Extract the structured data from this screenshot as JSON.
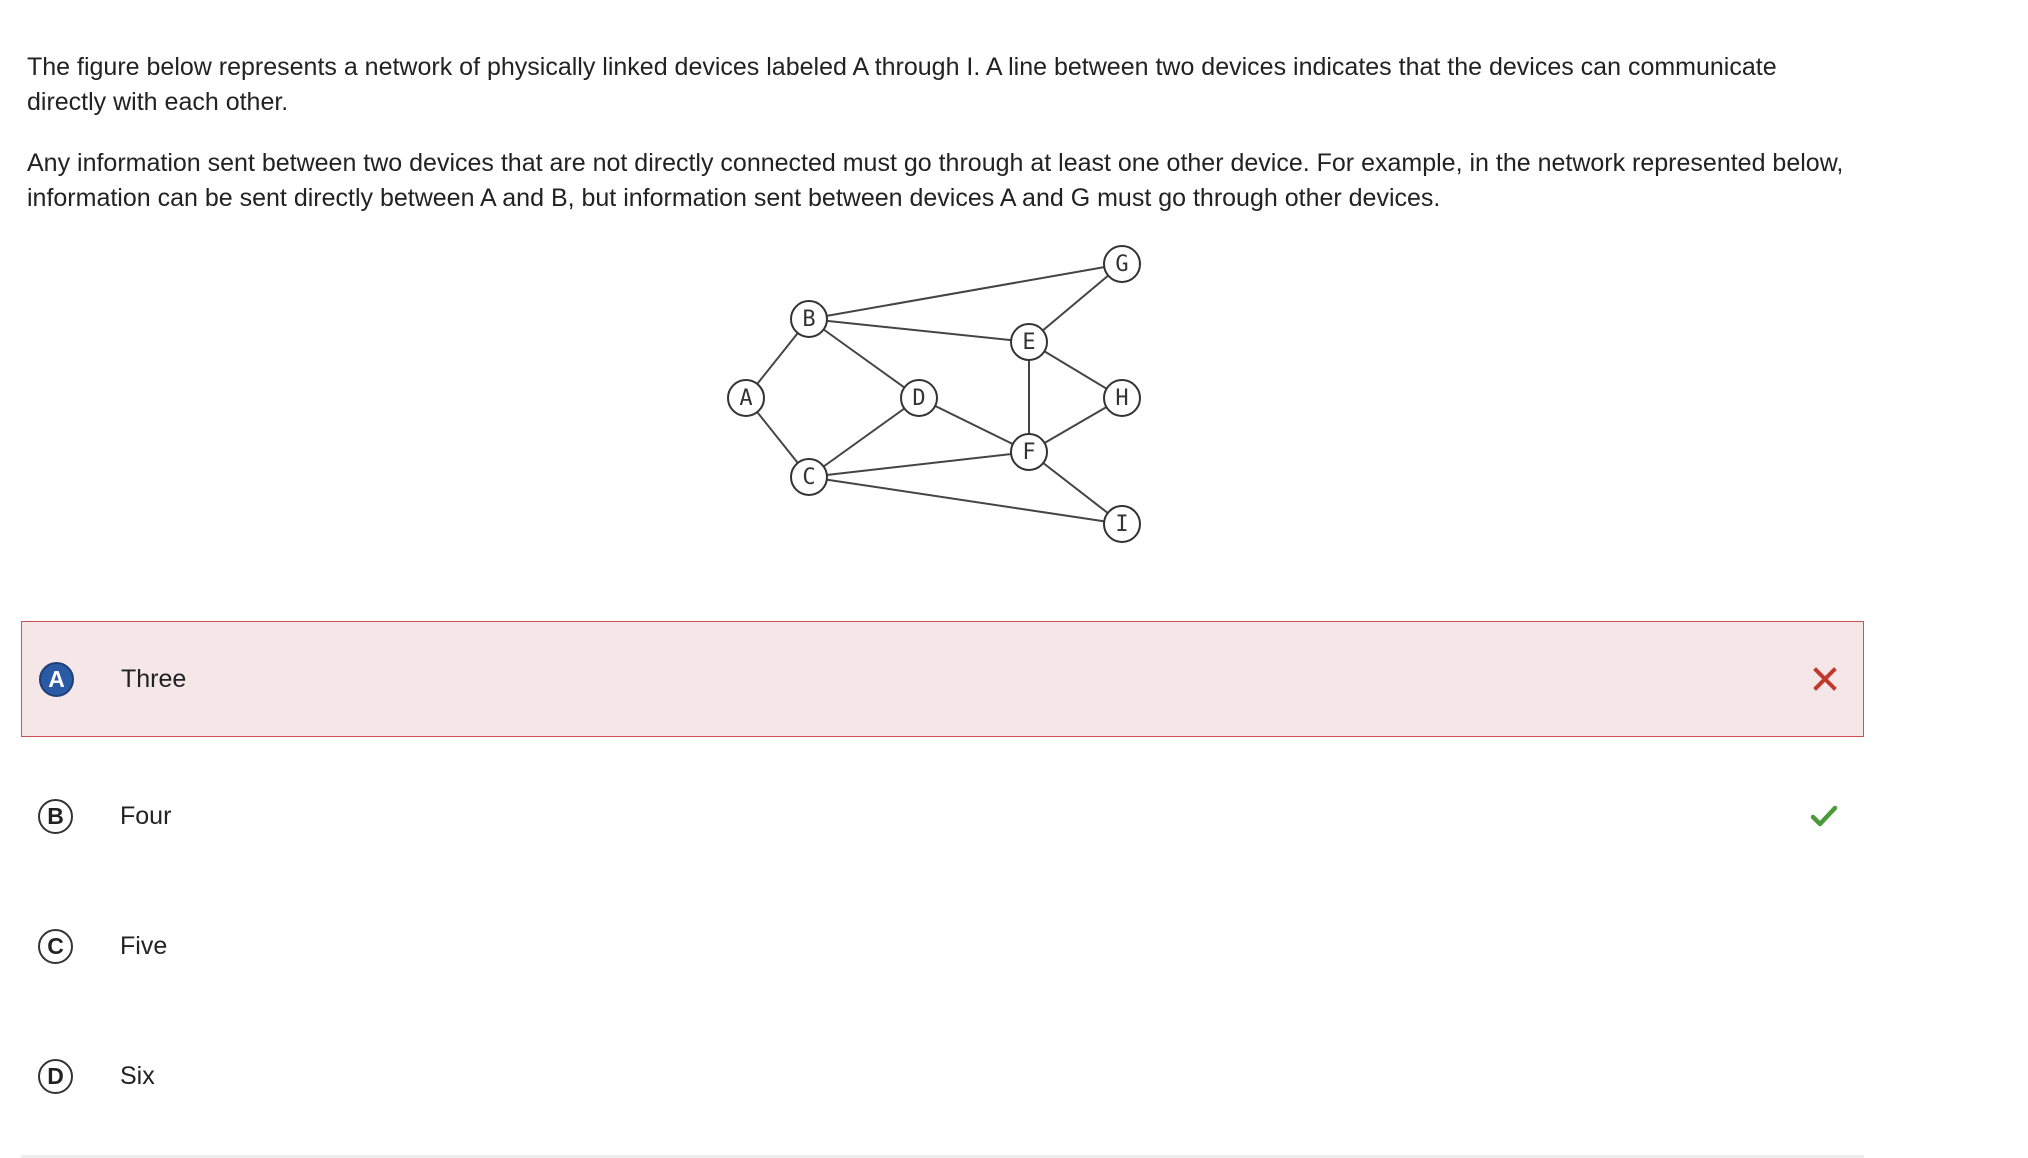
{
  "question": {
    "paragraph_1": "The figure below represents a network of physically linked devices labeled A through I. A line between two devices indicates that the devices can communicate directly with each other.",
    "paragraph_2": "Any information sent between two devices that are not directly connected must go through at least one other device. For example, in the network represented below, information can be sent directly between A and B, but information sent between devices A and G must go through other devices."
  },
  "network": {
    "nodes": [
      "A",
      "B",
      "C",
      "D",
      "E",
      "F",
      "G",
      "H",
      "I"
    ],
    "edges": [
      [
        "A",
        "B"
      ],
      [
        "A",
        "C"
      ],
      [
        "B",
        "D"
      ],
      [
        "B",
        "E"
      ],
      [
        "B",
        "G"
      ],
      [
        "C",
        "D"
      ],
      [
        "C",
        "F"
      ],
      [
        "C",
        "I"
      ],
      [
        "D",
        "F"
      ],
      [
        "E",
        "F"
      ],
      [
        "E",
        "G"
      ],
      [
        "E",
        "H"
      ],
      [
        "F",
        "H"
      ],
      [
        "F",
        "I"
      ]
    ]
  },
  "choices": [
    {
      "letter": "A",
      "text": "Three",
      "selected": true,
      "status": "incorrect",
      "mark_icon": "x-icon",
      "mark_color": "#c0392b"
    },
    {
      "letter": "B",
      "text": "Four",
      "selected": false,
      "status": "correct",
      "mark_icon": "check-icon",
      "mark_color": "#4a9a3a"
    },
    {
      "letter": "C",
      "text": "Five",
      "selected": false,
      "status": "none"
    },
    {
      "letter": "D",
      "text": "Six",
      "selected": false,
      "status": "none"
    }
  ],
  "colors": {
    "selected_background": "#f5e6e8",
    "selected_border": "#d0505a",
    "selected_badge": "#2b5aa5",
    "incorrect_mark": "#c0392b",
    "correct_mark": "#4a9a3a"
  }
}
